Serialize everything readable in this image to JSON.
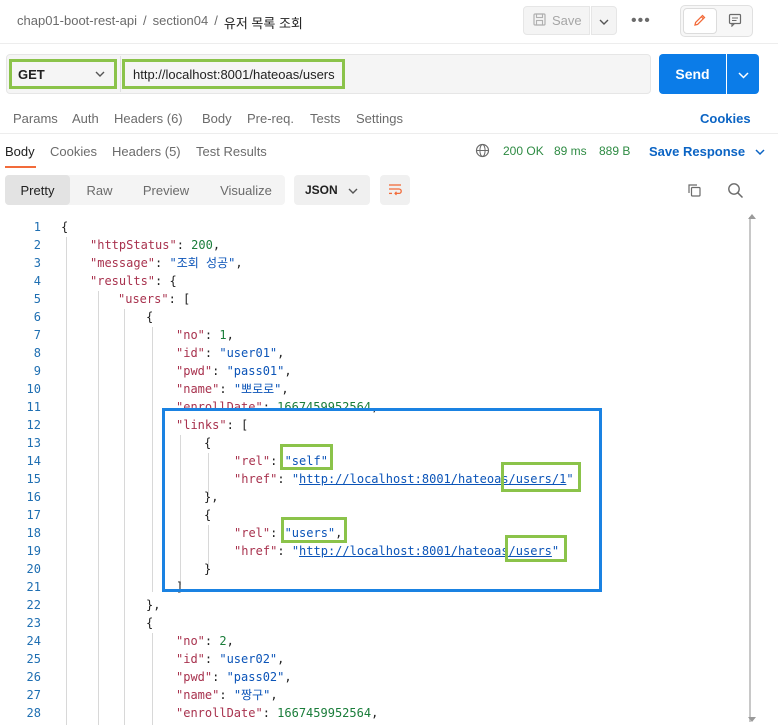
{
  "header": {
    "breadcrumb": [
      "chap01-boot-rest-api",
      "section04",
      "유저 목록 조회"
    ],
    "separator": "/",
    "save_label": "Save",
    "more_label": "•••"
  },
  "request": {
    "method": "GET",
    "url": "http://localhost:8001/hateoas/users",
    "send_label": "Send",
    "tabs": [
      "Params",
      "Auth",
      "Headers (6)",
      "Body",
      "Pre-req.",
      "Tests",
      "Settings"
    ],
    "cookies_label": "Cookies"
  },
  "response": {
    "tabs": [
      "Body",
      "Cookies",
      "Headers (5)",
      "Test Results"
    ],
    "status": "200 OK",
    "time": "89 ms",
    "size": "889 B",
    "save_response_label": "Save Response",
    "formats": [
      "Pretty",
      "Raw",
      "Preview",
      "Visualize"
    ],
    "language": "JSON"
  },
  "code_lines": [
    "{",
    "\"httpStatus\": 200,",
    "\"message\": \"조회 성공\",",
    "\"results\": {",
    "\"users\": [",
    "{",
    "\"no\": 1,",
    "\"id\": \"user01\",",
    "\"pwd\": \"pass01\",",
    "\"name\": \"뽀로로\",",
    "\"enrollDate\": 1667459952564,",
    "\"links\": [",
    "{",
    "\"rel\": \"self\",",
    "\"href\": \"http://localhost:8001/hateoas/users/1\"",
    "},",
    "{",
    "\"rel\": \"users\",",
    "\"href\": \"http://localhost:8001/hateoas/users\"",
    "}",
    "]",
    "},",
    "{",
    "\"no\": 2,",
    "\"id\": \"user02\",",
    "\"pwd\": \"pass02\",",
    "\"name\": \"짱구\",",
    "\"enrollDate\": 1667459952564,"
  ],
  "colors": {
    "accent_blue": "#0b7ce8",
    "highlight_green": "#8bc34a",
    "highlight_blue": "#1a82e2",
    "status_green": "#2e8b43",
    "key_color": "#a8324e",
    "string_color": "#0b54b8",
    "number_color": "#1a7d3a",
    "active_tab_underline": "#f26b3a"
  },
  "icons": [
    "save-icon",
    "chevron-down-icon",
    "more-icon",
    "edit-icon",
    "comment-icon",
    "globe-icon",
    "wrap-icon",
    "copy-icon",
    "search-icon"
  ]
}
